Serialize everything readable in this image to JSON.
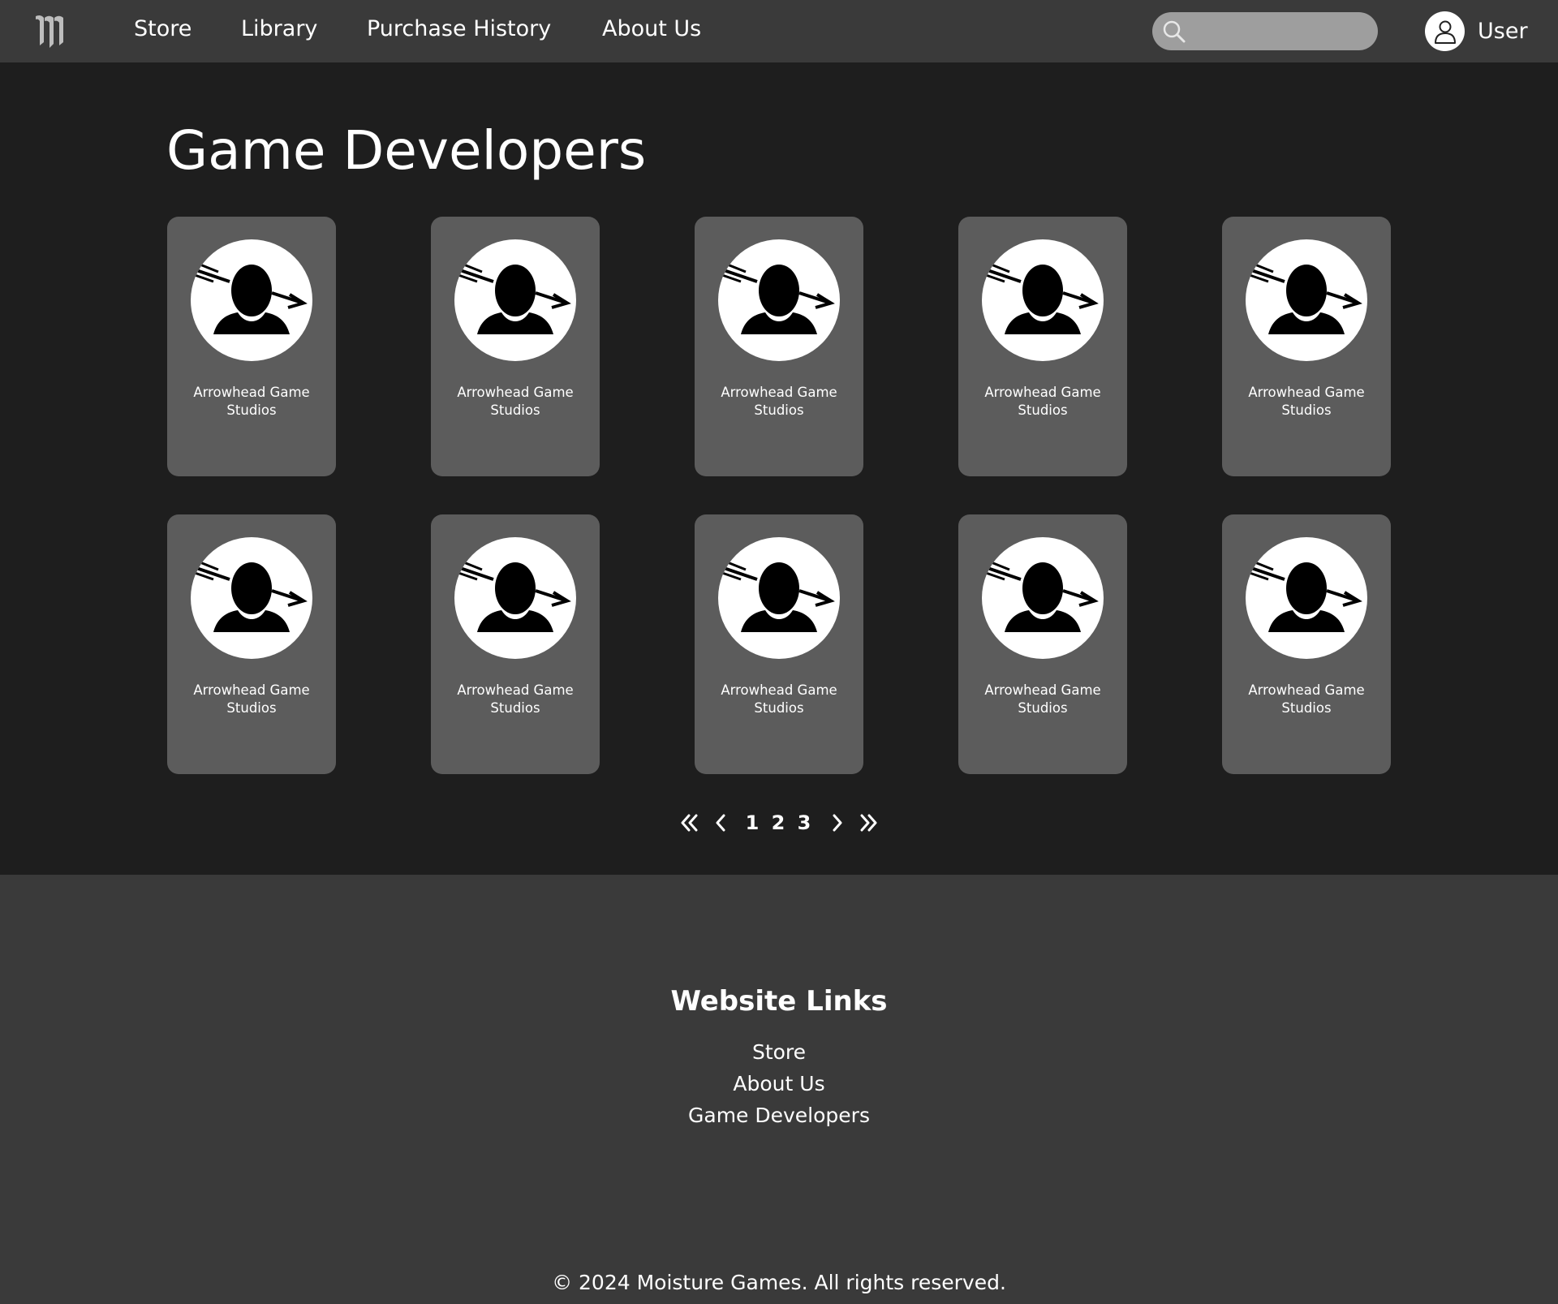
{
  "nav": {
    "logo_icon": "moisture-games-logo-icon",
    "links": [
      "Store",
      "Library",
      "Purchase History",
      "About Us"
    ],
    "search": {
      "placeholder": "",
      "icon": "search-icon"
    },
    "user": {
      "label": "User",
      "icon": "user-avatar-icon"
    }
  },
  "main": {
    "title": "Game Developers",
    "developers": [
      {
        "name": "Arrowhead Game Studios",
        "icon": "developer-logo-icon"
      },
      {
        "name": "Arrowhead Game Studios",
        "icon": "developer-logo-icon"
      },
      {
        "name": "Arrowhead Game Studios",
        "icon": "developer-logo-icon"
      },
      {
        "name": "Arrowhead Game Studios",
        "icon": "developer-logo-icon"
      },
      {
        "name": "Arrowhead Game Studios",
        "icon": "developer-logo-icon"
      },
      {
        "name": "Arrowhead Game Studios",
        "icon": "developer-logo-icon"
      },
      {
        "name": "Arrowhead Game Studios",
        "icon": "developer-logo-icon"
      },
      {
        "name": "Arrowhead Game Studios",
        "icon": "developer-logo-icon"
      },
      {
        "name": "Arrowhead Game Studios",
        "icon": "developer-logo-icon"
      },
      {
        "name": "Arrowhead Game Studios",
        "icon": "developer-logo-icon"
      }
    ],
    "pagination": {
      "first_icon": "double-chevron-left-icon",
      "prev_icon": "chevron-left-icon",
      "pages": [
        "1",
        "2",
        "3"
      ],
      "next_icon": "chevron-right-icon",
      "last_icon": "double-chevron-right-icon"
    }
  },
  "footer": {
    "heading": "Website Links",
    "links": [
      "Store",
      "About Us",
      "Game Developers"
    ],
    "copyright": "© 2024 Moisture Games. All rights reserved."
  },
  "colors": {
    "navbar_bg": "#3a3a3a",
    "page_bg": "#1e1e1e",
    "card_bg": "#5c5c5c",
    "search_bg": "#9e9e9e",
    "text": "#ffffff"
  }
}
